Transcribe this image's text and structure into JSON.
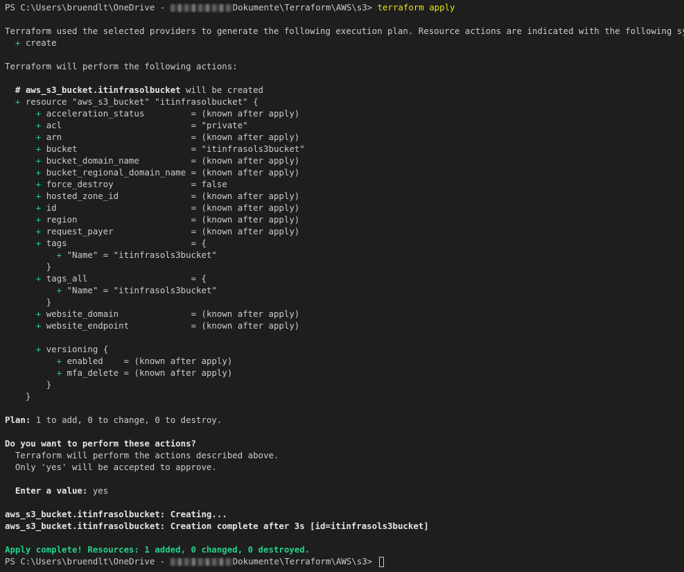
{
  "prompt": {
    "before": "PS C:\\Users\\bruendlt\\OneDrive - ",
    "after": "Dokumente\\Terraform\\AWS\\s3> ",
    "command": "terraform apply"
  },
  "intro": {
    "line1": "Terraform used the selected providers to generate the following execution plan. Resource actions are indicated with the following symbols:",
    "symbol": "  + ",
    "symbol_label": "create"
  },
  "actions_header": "Terraform will perform the following actions:",
  "resource": {
    "comment_prefix": "  # ",
    "address": "aws_s3_bucket.itinfrasolbucket",
    "comment_suffix": " will be created",
    "open_plus": "  + ",
    "open": "resource \"aws_s3_bucket\" \"itinfrasolbucket\" {",
    "attributes": [
      {
        "name": "acceleration_status",
        "value": "(known after apply)"
      },
      {
        "name": "acl",
        "value": "\"private\""
      },
      {
        "name": "arn",
        "value": "(known after apply)"
      },
      {
        "name": "bucket",
        "value": "\"itinfrasols3bucket\""
      },
      {
        "name": "bucket_domain_name",
        "value": "(known after apply)"
      },
      {
        "name": "bucket_regional_domain_name",
        "value": "(known after apply)"
      },
      {
        "name": "force_destroy",
        "value": "false"
      },
      {
        "name": "hosted_zone_id",
        "value": "(known after apply)"
      },
      {
        "name": "id",
        "value": "(known after apply)"
      },
      {
        "name": "region",
        "value": "(known after apply)"
      },
      {
        "name": "request_payer",
        "value": "(known after apply)"
      }
    ],
    "tags_label": "tags",
    "tags_all_label": "tags_all",
    "open_brace": "{",
    "tag_entry": "\"Name\" = \"itinfrasols3bucket\"",
    "close_brace": "}",
    "attributes2": [
      {
        "name": "website_domain",
        "value": "(known after apply)"
      },
      {
        "name": "website_endpoint",
        "value": "(known after apply)"
      }
    ],
    "versioning_open": "versioning {",
    "versioning": [
      {
        "name": "enabled   ",
        "value": "(known after apply)"
      },
      {
        "name": "mfa_delete",
        "value": "(known after apply)"
      }
    ]
  },
  "plan": {
    "label": "Plan:",
    "text": " 1 to add, 0 to change, 0 to destroy."
  },
  "confirm": {
    "question": "Do you want to perform these actions?",
    "line1": "  Terraform will perform the actions described above.",
    "line2": "  Only 'yes' will be accepted to approve.",
    "enter_label": "  Enter a value:",
    "enter_value": " yes"
  },
  "progress": {
    "creating": "aws_s3_bucket.itinfrasolbucket: Creating...",
    "complete": "aws_s3_bucket.itinfrasolbucket: Creation complete after 3s [id=itinfrasols3bucket]"
  },
  "result": "Apply complete! Resources: 1 added, 0 changed, 0 destroyed."
}
